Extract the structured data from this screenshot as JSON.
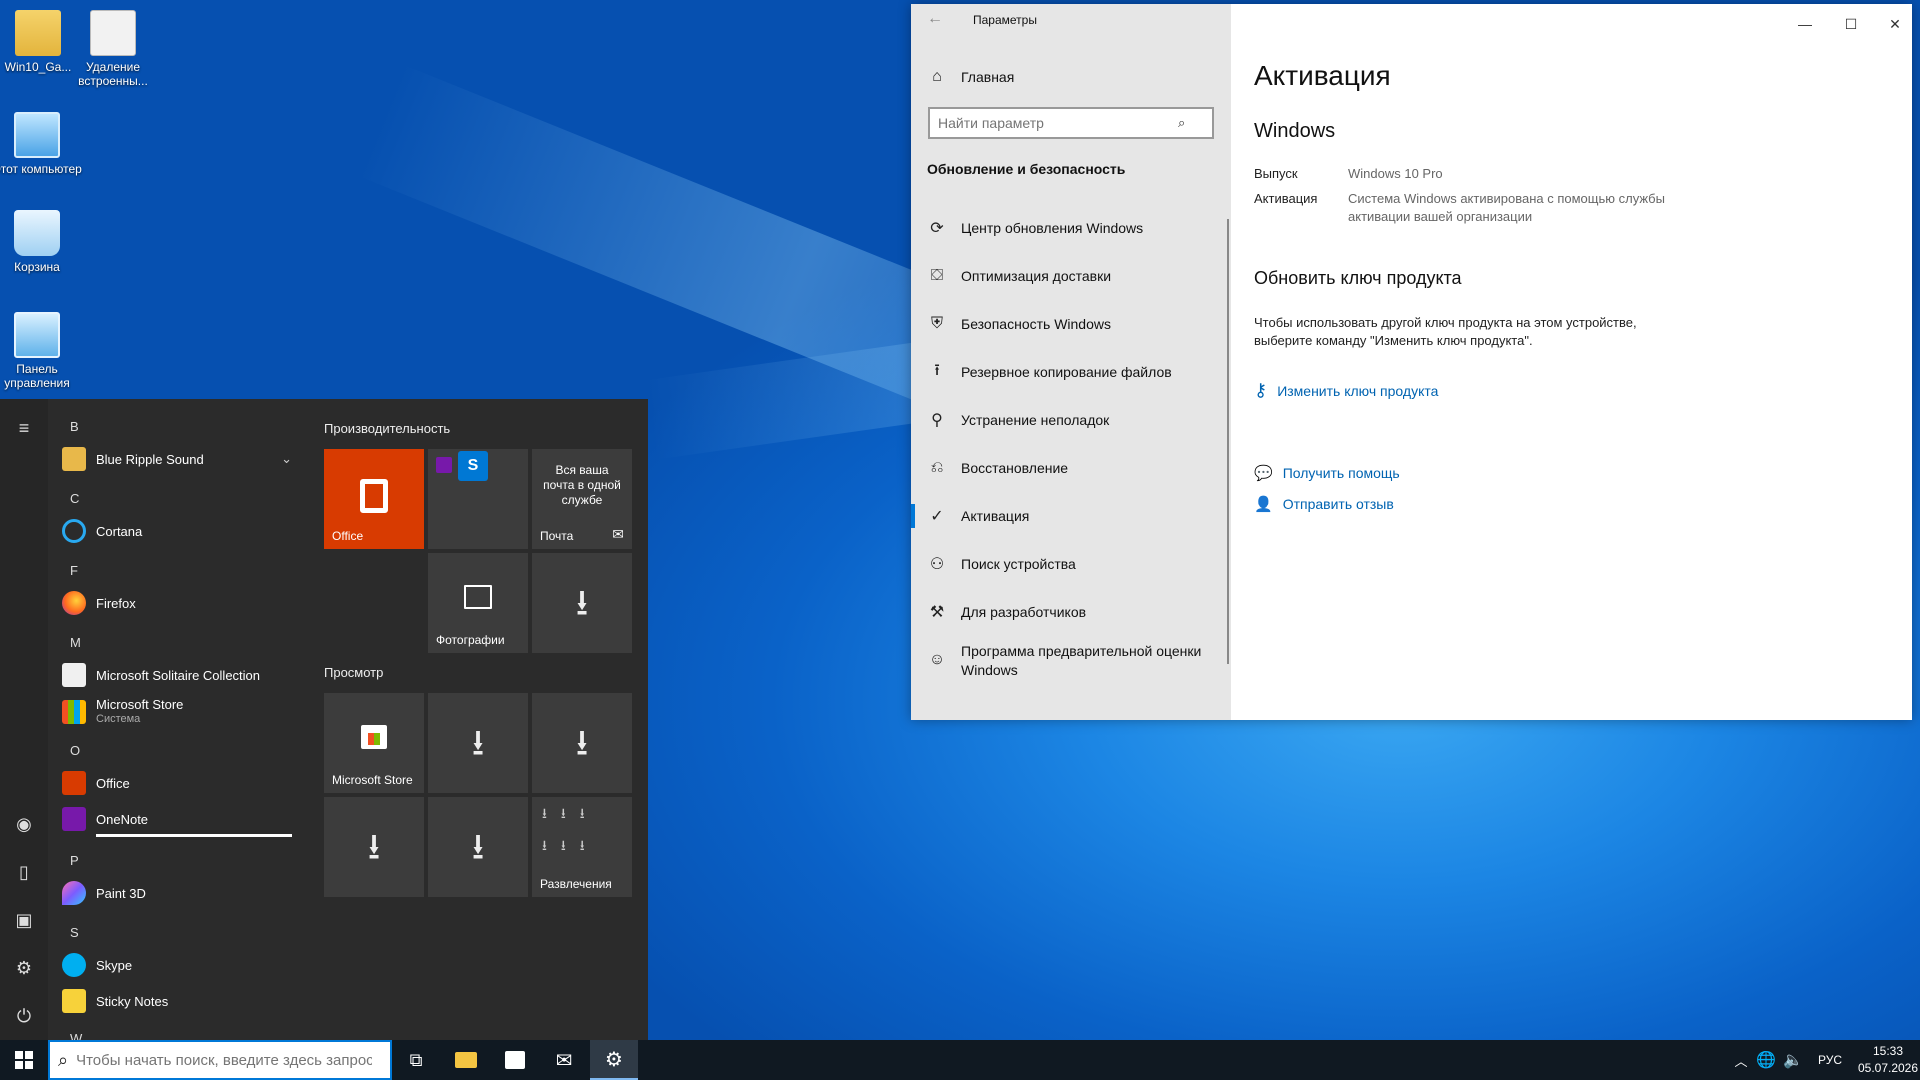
{
  "desktop": {
    "icons": [
      {
        "label": "Win10_Ga..."
      },
      {
        "label": "Удаление встроенны..."
      },
      {
        "label": "Этот компьютер"
      },
      {
        "label": "Корзина"
      },
      {
        "label": "Панель управления"
      }
    ]
  },
  "start": {
    "letters": [
      "B",
      "C",
      "F",
      "M",
      "O",
      "P",
      "S",
      "W"
    ],
    "apps": [
      {
        "label": "Blue Ripple Sound",
        "sub": ""
      },
      {
        "label": "Cortana",
        "sub": ""
      },
      {
        "label": "Firefox",
        "sub": ""
      },
      {
        "label": "Microsoft Solitaire Collection",
        "sub": ""
      },
      {
        "label": "Microsoft Store",
        "sub": "Система"
      },
      {
        "label": "Office",
        "sub": ""
      },
      {
        "label": "OneNote",
        "sub": ""
      },
      {
        "label": "Paint 3D",
        "sub": ""
      },
      {
        "label": "Skype",
        "sub": ""
      },
      {
        "label": "Sticky Notes",
        "sub": ""
      }
    ],
    "groups": [
      "Производительность",
      "Просмотр"
    ],
    "tiles": {
      "office": "Office",
      "mail_desc": "Вся ваша почта в одной службе",
      "mail": "Почта",
      "photos": "Фотографии",
      "store": "Microsoft Store",
      "entertainment": "Развлечения"
    }
  },
  "taskbar": {
    "search_placeholder": "Чтобы начать поиск, введите здесь запрос",
    "lang": "РУС",
    "time": "15:33",
    "date": "05.07.2026"
  },
  "settings": {
    "title": "Параметры",
    "home": "Главная",
    "search_placeholder": "Найти параметр",
    "section": "Обновление и безопасность",
    "nav": [
      {
        "label": "Центр обновления Windows",
        "icon": "refresh-icon"
      },
      {
        "label": "Оптимизация доставки",
        "icon": "delivery-icon"
      },
      {
        "label": "Безопасность Windows",
        "icon": "shield-icon"
      },
      {
        "label": "Резервное копирование файлов",
        "icon": "backup-icon"
      },
      {
        "label": "Устранение неполадок",
        "icon": "wrench-icon"
      },
      {
        "label": "Восстановление",
        "icon": "recovery-icon"
      },
      {
        "label": "Активация",
        "icon": "check-circle-icon"
      },
      {
        "label": "Поиск устройства",
        "icon": "person-pin-icon"
      },
      {
        "label": "Для разработчиков",
        "icon": "developer-icon"
      },
      {
        "label": "Программа предварительной оценки Windows",
        "icon": "insider-icon"
      }
    ],
    "page_title": "Активация",
    "windows_header": "Windows",
    "edition_label": "Выпуск",
    "edition_value": "Windows 10 Pro",
    "activation_label": "Активация",
    "activation_value": "Система Windows активирована с помощью службы активации вашей организации",
    "update_key_title": "Обновить ключ продукта",
    "update_key_desc": "Чтобы использовать другой ключ продукта на этом устройстве, выберите команду \"Изменить ключ продукта\".",
    "change_key_link": "Изменить ключ продукта",
    "help_link": "Получить помощь",
    "feedback_link": "Отправить отзыв"
  }
}
